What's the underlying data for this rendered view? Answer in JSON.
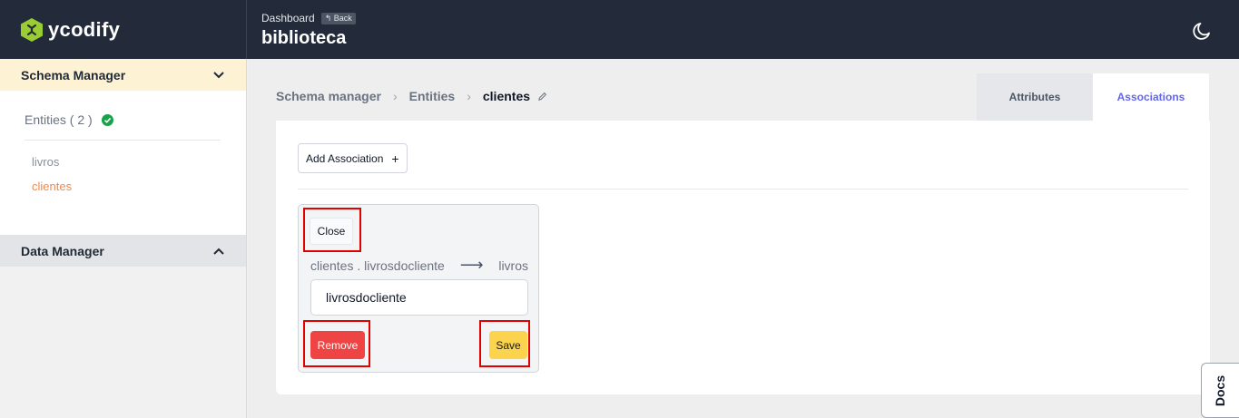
{
  "brand": {
    "name": "ycodify"
  },
  "header": {
    "breadcrumb_label": "Dashboard",
    "back_label": "Back",
    "project_title": "biblioteca"
  },
  "sidebar": {
    "schema_manager": {
      "title": "Schema Manager",
      "entities_label": "Entities ( 2 )",
      "entities": [
        "livros",
        "clientes"
      ],
      "active_entity": "clientes"
    },
    "data_manager": {
      "title": "Data Manager"
    }
  },
  "breadcrumb": {
    "items": [
      "Schema manager",
      "Entities",
      "clientes"
    ]
  },
  "tabs": [
    {
      "label": "Attributes",
      "active": false
    },
    {
      "label": "Associations",
      "active": true
    }
  ],
  "panel": {
    "add_button_label": "Add Association",
    "add_icon": "+",
    "association": {
      "close_label": "Close",
      "source": "clientes . livrosdocliente",
      "arrow": "⟶",
      "target": "livros",
      "name_value": "livrosdocliente",
      "remove_label": "Remove",
      "save_label": "Save"
    }
  },
  "docs_tab_label": "Docs",
  "colors": {
    "topbar": "#232b3a",
    "active_tab": "#6366f1",
    "active_entity": "#f08a4b",
    "remove": "#ef4444",
    "save": "#fcd34d",
    "highlight": "#e50000"
  }
}
